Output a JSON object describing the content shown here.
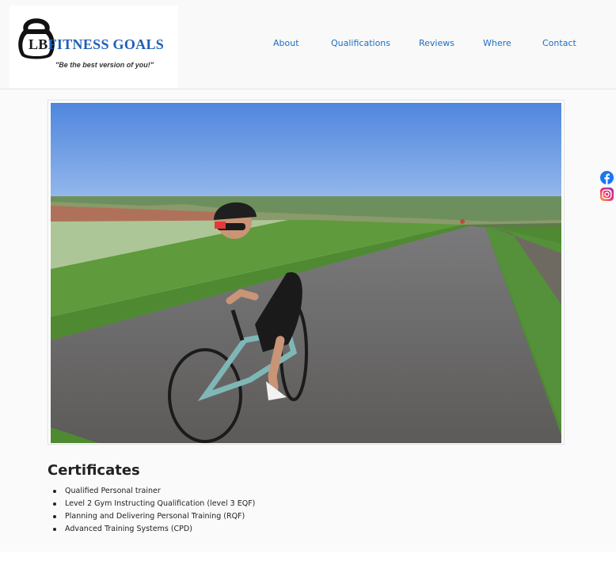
{
  "logo": {
    "word_part1": "LB",
    "word_part2": "FITNESS G",
    "word_part3": "O",
    "word_part4": "ALS",
    "tagline": "\"Be the best version of you!\""
  },
  "nav": {
    "items": [
      {
        "label": "About"
      },
      {
        "label": "Qualifications"
      },
      {
        "label": "Reviews"
      },
      {
        "label": "Where"
      },
      {
        "label": "Contact"
      }
    ]
  },
  "social": {
    "icons": [
      "facebook-icon",
      "instagram-icon"
    ]
  },
  "certificates": {
    "title": "Certificates",
    "items": [
      "Qualified Personal trainer",
      "Level 2 Gym Instructing Qualification (level 3 EQF)",
      "Planning and Delivering Personal Training (RQF)",
      "Advanced Training Systems (CPD)"
    ]
  },
  "colors": {
    "nav_link": "#1a6fc4",
    "logo_blue": "#1f5fb8",
    "heading": "#222222"
  }
}
